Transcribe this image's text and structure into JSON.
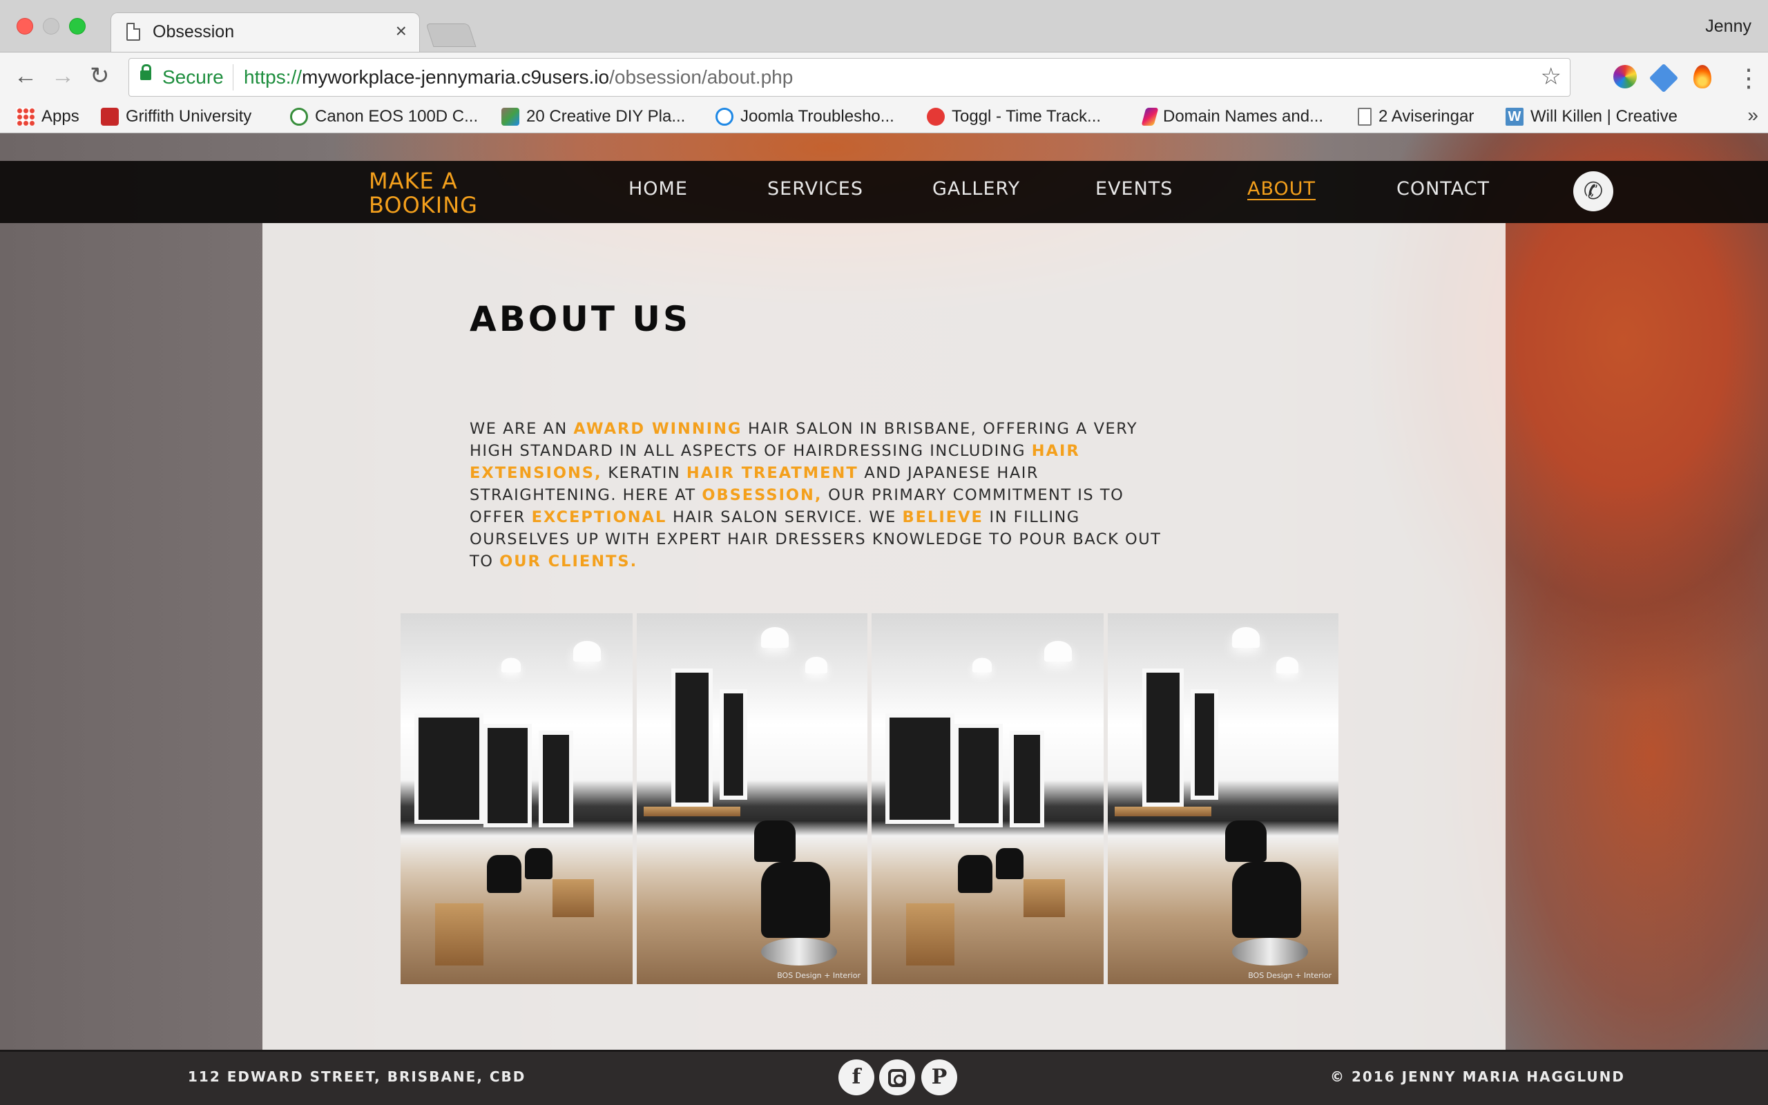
{
  "browser": {
    "tab_title": "Obsession",
    "tab_close": "×",
    "profile_name": "Jenny",
    "secure_label": "Secure",
    "url_scheme": "https://",
    "url_host": "myworkplace-jennymaria.c9users.io",
    "url_path": "/obsession/about.php",
    "bookmarks": [
      {
        "label": "Apps",
        "icon": "apps-grid-icon"
      },
      {
        "label": "Griffith University",
        "icon": "griffith-icon"
      },
      {
        "label": "Canon EOS 100D C...",
        "icon": "canon-icon"
      },
      {
        "label": "20 Creative DIY Pla...",
        "icon": "diy-icon"
      },
      {
        "label": "Joomla Troublesho...",
        "icon": "joomla-icon"
      },
      {
        "label": "Toggl - Time Track...",
        "icon": "toggl-icon"
      },
      {
        "label": "Domain Names and...",
        "icon": "domain-icon"
      },
      {
        "label": "2 Aviseringar",
        "icon": "document-icon"
      },
      {
        "label": "Will Killen | Creative",
        "icon": "will-killen-icon",
        "glyph": "W"
      }
    ],
    "bookmarks_overflow": "»"
  },
  "site": {
    "booking_line1": "MAKE A",
    "booking_line2": "BOOKING",
    "nav": {
      "home": "HOME",
      "services": "SERVICES",
      "gallery": "GALLERY",
      "events": "EVENTS",
      "about": "ABOUT",
      "contact": "CONTACT"
    },
    "accent_color": "#f4a01c",
    "phone_icon": "phone-icon"
  },
  "about": {
    "heading": "ABOUT US",
    "body": [
      {
        "text": "WE ARE AN ",
        "hl": false
      },
      {
        "text": "AWARD WINNING",
        "hl": true
      },
      {
        "text": " HAIR SALON IN BRISBANE, OFFERING A VERY HIGH STANDARD IN ALL ASPECTS OF HAIRDRESSING INCLUDING ",
        "hl": false
      },
      {
        "text": "HAIR EXTENSIONS,",
        "hl": true
      },
      {
        "text": " KERATIN ",
        "hl": false
      },
      {
        "text": "HAIR TREATMENT",
        "hl": true
      },
      {
        "text": " AND JAPANESE HAIR STRAIGHTENING. HERE AT ",
        "hl": false
      },
      {
        "text": "OBSESSION,",
        "hl": true
      },
      {
        "text": " OUR PRIMARY COMMITMENT IS TO OFFER ",
        "hl": false
      },
      {
        "text": "EXCEPTIONAL",
        "hl": true
      },
      {
        "text": " HAIR SALON SERVICE. WE ",
        "hl": false
      },
      {
        "text": "BELIEVE",
        "hl": true
      },
      {
        "text": " IN FILLING OURSELVES UP WITH EXPERT HAIR DRESSERS KNOWLEDGE TO POUR BACK OUT TO ",
        "hl": false
      },
      {
        "text": "OUR CLIENTS.",
        "hl": true
      }
    ],
    "photos": [
      {
        "alt": "salon interior wide",
        "watermark": ""
      },
      {
        "alt": "salon interior chairs",
        "watermark": "BOS Design + Interior"
      },
      {
        "alt": "salon interior wide",
        "watermark": ""
      },
      {
        "alt": "salon interior chairs",
        "watermark": "BOS Design + Interior"
      }
    ]
  },
  "footer": {
    "address": "112 EDWARD STREET, BRISBANE, CBD",
    "copyright": "© 2016 JENNY MARIA HAGGLUND",
    "social": [
      {
        "name": "facebook",
        "glyph": "f"
      },
      {
        "name": "instagram",
        "glyph": ""
      },
      {
        "name": "pinterest",
        "glyph": "P"
      }
    ]
  }
}
